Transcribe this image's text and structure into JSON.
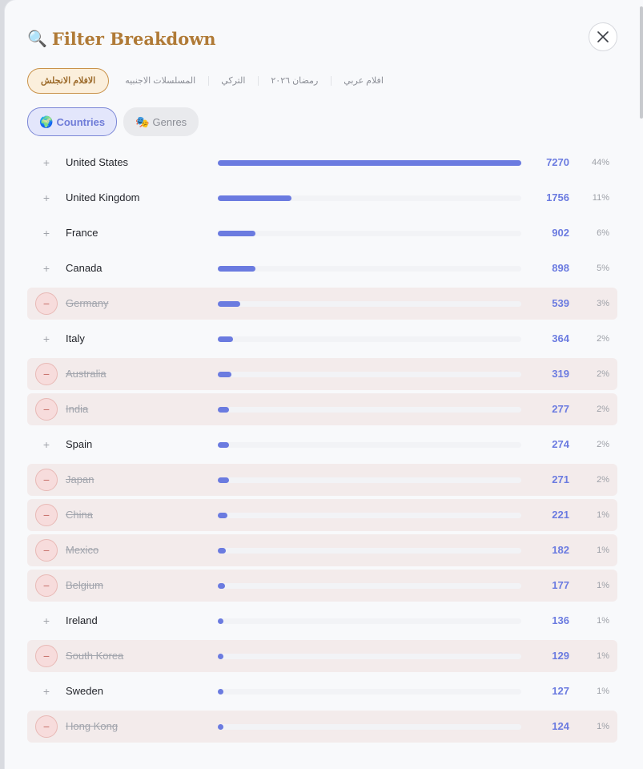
{
  "header": {
    "icon": "🔍",
    "title": "Filter Breakdown"
  },
  "tabs": [
    {
      "label": "الافلام الانجلش",
      "active": true
    },
    {
      "label": "المسلسلات الاجنبيه",
      "active": false
    },
    {
      "label": "التركي",
      "active": false
    },
    {
      "label": "رمضان ٢٠٢٦",
      "active": false
    },
    {
      "label": "افلام عربي",
      "active": false
    }
  ],
  "toggles": {
    "countries": {
      "icon": "🌍",
      "label": "Countries",
      "active": true
    },
    "genres": {
      "icon": "🎭",
      "label": "Genres",
      "active": false
    }
  },
  "colors": {
    "accent": "#6b7be0",
    "title": "#b07a36",
    "excluded_bg": "#f3ebeb"
  },
  "rows": [
    {
      "name": "United States",
      "count": "7270",
      "pct": "44%",
      "excluded": false,
      "control": "+"
    },
    {
      "name": "United Kingdom",
      "count": "1756",
      "pct": "11%",
      "excluded": false,
      "control": "+"
    },
    {
      "name": "France",
      "count": "902",
      "pct": "6%",
      "excluded": false,
      "control": "+"
    },
    {
      "name": "Canada",
      "count": "898",
      "pct": "5%",
      "excluded": false,
      "control": "+"
    },
    {
      "name": "Germany",
      "count": "539",
      "pct": "3%",
      "excluded": true,
      "control": "−"
    },
    {
      "name": "Italy",
      "count": "364",
      "pct": "2%",
      "excluded": false,
      "control": "+"
    },
    {
      "name": "Australia",
      "count": "319",
      "pct": "2%",
      "excluded": true,
      "control": "−"
    },
    {
      "name": "India",
      "count": "277",
      "pct": "2%",
      "excluded": true,
      "control": "−"
    },
    {
      "name": "Spain",
      "count": "274",
      "pct": "2%",
      "excluded": false,
      "control": "+"
    },
    {
      "name": "Japan",
      "count": "271",
      "pct": "2%",
      "excluded": true,
      "control": "−"
    },
    {
      "name": "China",
      "count": "221",
      "pct": "1%",
      "excluded": true,
      "control": "−"
    },
    {
      "name": "Mexico",
      "count": "182",
      "pct": "1%",
      "excluded": true,
      "control": "−"
    },
    {
      "name": "Belgium",
      "count": "177",
      "pct": "1%",
      "excluded": true,
      "control": "−"
    },
    {
      "name": "Ireland",
      "count": "136",
      "pct": "1%",
      "excluded": false,
      "control": "+"
    },
    {
      "name": "South Korea",
      "count": "129",
      "pct": "1%",
      "excluded": true,
      "control": "−"
    },
    {
      "name": "Sweden",
      "count": "127",
      "pct": "1%",
      "excluded": false,
      "control": "+"
    },
    {
      "name": "Hong Kong",
      "count": "124",
      "pct": "1%",
      "excluded": true,
      "control": "−"
    },
    {
      "name": "",
      "count": "",
      "pct": "",
      "excluded": false,
      "control": ""
    }
  ]
}
